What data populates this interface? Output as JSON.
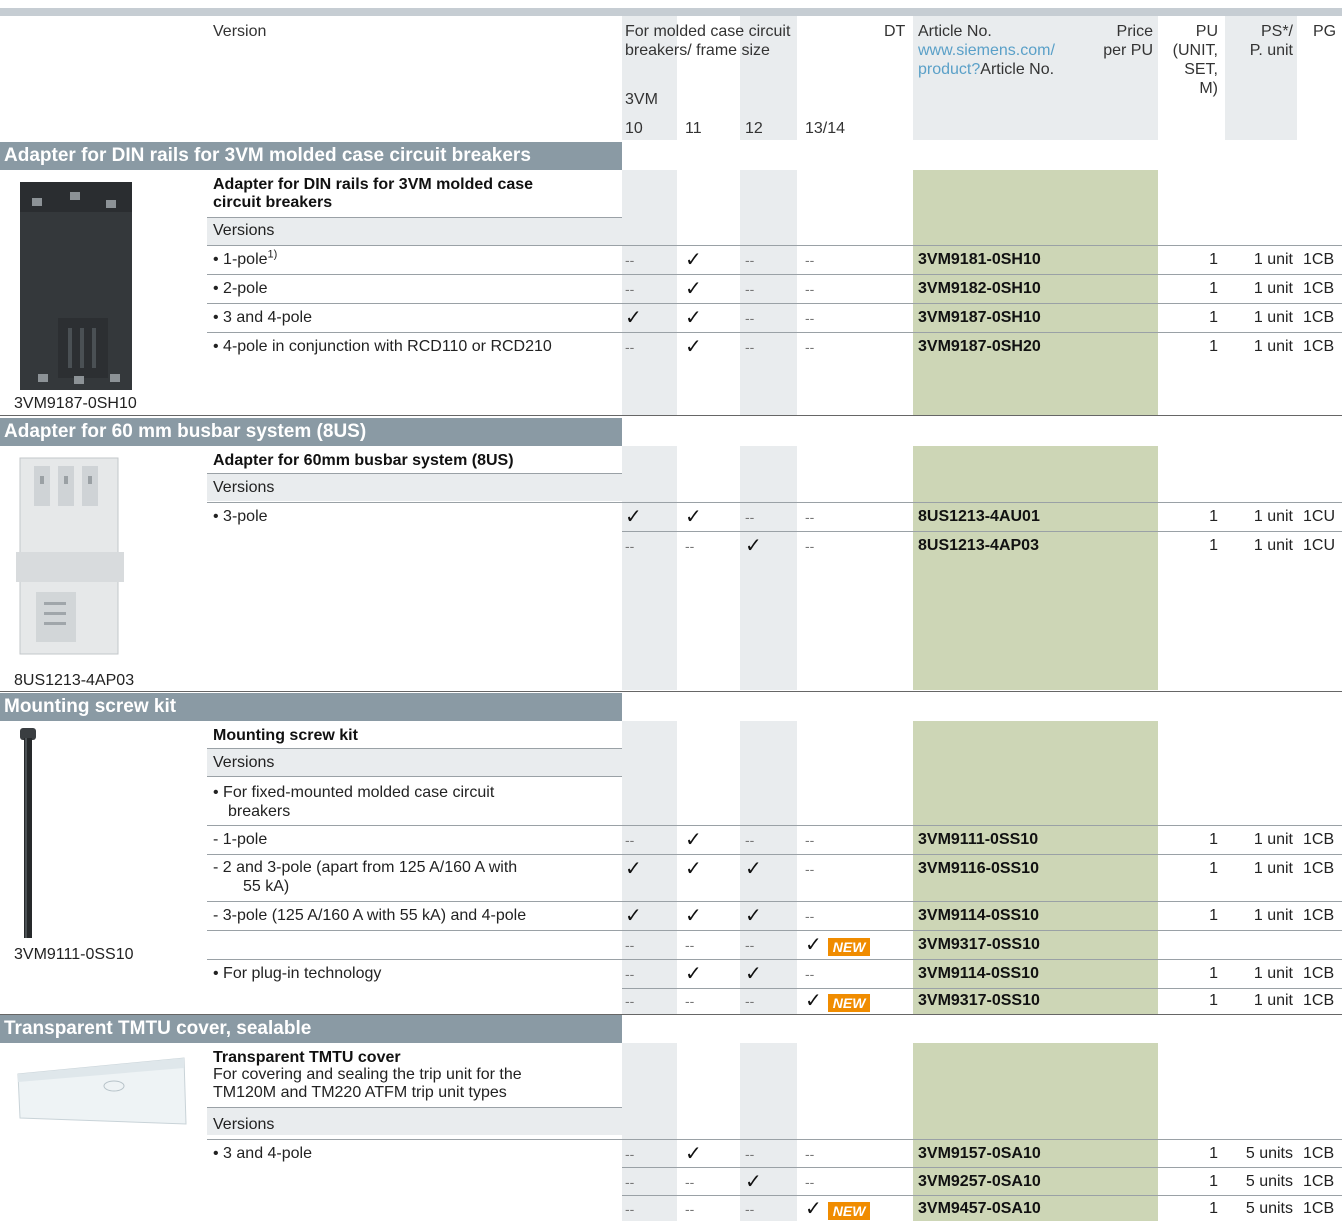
{
  "header": {
    "version": "Version",
    "for_molded_line1": "For molded case circuit",
    "for_molded_line2": "breakers/ frame size",
    "family": "3VM",
    "frame_sizes": [
      "10",
      "11",
      "12",
      "13/14"
    ],
    "dt": "DT",
    "article_no": "Article No.",
    "link_line1": "www.siemens.com/",
    "link_line2": "product?",
    "link_suffix": "Article No.",
    "price_line1": "Price",
    "price_line2": "per PU",
    "pu_line1": "PU",
    "pu_line2": "(UNIT,",
    "pu_line3": "SET,",
    "pu_line4": "M)",
    "ps_line1": "PS*/",
    "ps_line2": "P. unit",
    "pg": "PG"
  },
  "new_badge": "NEW",
  "check": "✓",
  "dash": "--",
  "sections": [
    {
      "heading": "Adapter for DIN rails for 3VM molded case circuit breakers",
      "title_line1": "Adapter for DIN rails for 3VM molded case",
      "title_line2": "circuit breakers",
      "versions_label": "Versions",
      "image_caption": "3VM9187-0SH10",
      "rows": [
        {
          "label": "• 1-pole",
          "sup": "1)",
          "f10": "--",
          "f11": "✓",
          "f12": "--",
          "f1314": "--",
          "article": "3VM9181-0SH10",
          "pu": "1",
          "ps": "1 unit",
          "pg": "1CB"
        },
        {
          "label": "• 2-pole",
          "f10": "--",
          "f11": "✓",
          "f12": "--",
          "f1314": "--",
          "article": "3VM9182-0SH10",
          "pu": "1",
          "ps": "1 unit",
          "pg": "1CB"
        },
        {
          "label": "• 3 and 4-pole",
          "f10": "✓",
          "f11": "✓",
          "f12": "--",
          "f1314": "--",
          "article": "3VM9187-0SH10",
          "pu": "1",
          "ps": "1 unit",
          "pg": "1CB"
        },
        {
          "label": "• 4-pole in conjunction with RCD110 or RCD210",
          "f10": "--",
          "f11": "✓",
          "f12": "--",
          "f1314": "--",
          "article": "3VM9187-0SH20",
          "pu": "1",
          "ps": "1 unit",
          "pg": "1CB"
        }
      ]
    },
    {
      "heading": "Adapter for 60 mm busbar system (8US)",
      "title_line1": "Adapter for 60mm busbar system (8US)",
      "versions_label": "Versions",
      "image_caption": "8US1213-4AP03",
      "rows": [
        {
          "label": "• 3-pole",
          "f10": "✓",
          "f11": "✓",
          "f12": "--",
          "f1314": "--",
          "article": "8US1213-4AU01",
          "pu": "1",
          "ps": "1 unit",
          "pg": "1CU"
        },
        {
          "label": "",
          "f10": "--",
          "f11": "--",
          "f12": "✓",
          "f1314": "--",
          "article": "8US1213-4AP03",
          "pu": "1",
          "ps": "1 unit",
          "pg": "1CU"
        }
      ]
    },
    {
      "heading": "Mounting screw kit",
      "title_line1": "Mounting screw kit",
      "versions_label": "Versions",
      "image_caption": "3VM9111-0SS10",
      "fixed_line1": "• For fixed-mounted molded case circuit",
      "fixed_line2": "breakers",
      "rows": [
        {
          "label": "- 1-pole",
          "f10": "--",
          "f11": "✓",
          "f12": "--",
          "f1314": "--",
          "article": "3VM9111-0SS10",
          "pu": "1",
          "ps": "1 unit",
          "pg": "1CB"
        },
        {
          "label": "- 2 and 3-pole (apart from 125 A/160 A with",
          "label2": "55 kA)",
          "f10": "✓",
          "f11": "✓",
          "f12": "✓",
          "f1314": "--",
          "article": "3VM9116-0SS10",
          "pu": "1",
          "ps": "1 unit",
          "pg": "1CB"
        },
        {
          "label": "- 3-pole (125 A/160 A with 55 kA) and 4-pole",
          "f10": "✓",
          "f11": "✓",
          "f12": "✓",
          "f1314": "--",
          "article": "3VM9114-0SS10",
          "pu": "1",
          "ps": "1 unit",
          "pg": "1CB"
        },
        {
          "label": "",
          "f10": "--",
          "f11": "--",
          "f12": "--",
          "f1314": "✓",
          "is_new": true,
          "article": "3VM9317-0SS10",
          "pu": "",
          "ps": "",
          "pg": ""
        },
        {
          "label": "• For plug-in technology",
          "f10": "--",
          "f11": "✓",
          "f12": "✓",
          "f1314": "--",
          "article": "3VM9114-0SS10",
          "pu": "1",
          "ps": "1 unit",
          "pg": "1CB"
        },
        {
          "label": "",
          "f10": "--",
          "f11": "--",
          "f12": "--",
          "f1314": "✓",
          "is_new": true,
          "article": "3VM9317-0SS10",
          "pu": "1",
          "ps": "1 unit",
          "pg": "1CB"
        }
      ]
    },
    {
      "heading": "Transparent TMTU cover, sealable",
      "title_line1": "Transparent TMTU cover",
      "desc_line1": "For covering and sealing the trip unit for the",
      "desc_line2": "TM120M and TM220 ATFM trip unit types",
      "versions_label": "Versions",
      "rows": [
        {
          "label": "• 3 and 4-pole",
          "f10": "--",
          "f11": "✓",
          "f12": "--",
          "f1314": "--",
          "article": "3VM9157-0SA10",
          "pu": "1",
          "ps": "5 units",
          "pg": "1CB"
        },
        {
          "label": "",
          "f10": "--",
          "f11": "--",
          "f12": "✓",
          "f1314": "--",
          "article": "3VM9257-0SA10",
          "pu": "1",
          "ps": "5 units",
          "pg": "1CB"
        },
        {
          "label": "",
          "f10": "--",
          "f11": "--",
          "f12": "--",
          "f1314": "✓",
          "is_new": true,
          "article": "3VM9457-0SA10",
          "pu": "1",
          "ps": "5 units",
          "pg": "1CB"
        }
      ]
    }
  ]
}
